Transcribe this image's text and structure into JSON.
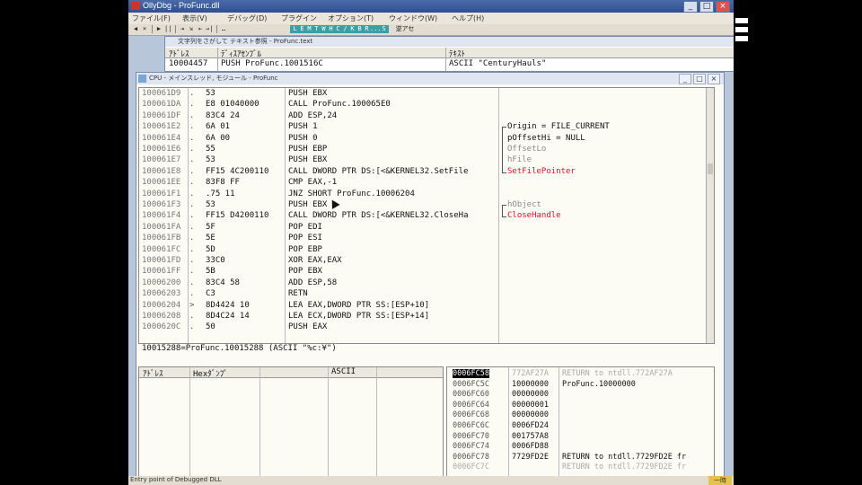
{
  "window": {
    "title": "OllyDbg - ProFunc.dll",
    "controls": [
      "_",
      "□",
      "×"
    ]
  },
  "menu": [
    "ファイル(F)",
    "表示(V)",
    "デバッグ(D)",
    "プラグイン",
    "オプション(T)",
    "ウィンドウ(W)",
    "ヘルプ(H)"
  ],
  "toolbar": {
    "buttons": [
      "◀",
      "×",
      "▶",
      "||",
      "⇥",
      "⇲",
      "⇤",
      "→|",
      "…"
    ],
    "letters": [
      "L",
      "E",
      "M",
      "T",
      "W",
      "H",
      "C",
      "/",
      "K",
      "B",
      "R",
      "...",
      "S"
    ],
    "help": "逆アセ"
  },
  "references": {
    "title": "文字列をさがして テキスト参照 - ProFunc.text",
    "headers": {
      "address": "ｱﾄﾞﾚｽ",
      "disasm": "ﾃﾞｨｽｱｾﾝﾌﾞﾙ",
      "text": "ﾃｷｽﾄ"
    },
    "row": {
      "address": "10004457",
      "disasm": "PUSH ProFunc.1001516C",
      "text": "ASCII \"CenturyHauls\""
    }
  },
  "cpu": {
    "title": "CPU - メインスレッド, モジュール - ProFunc",
    "rows": [
      {
        "addr": "100061D9",
        "mark": ".",
        "hex": "53",
        "instr": "PUSH EBX"
      },
      {
        "addr": "100061DA",
        "mark": ".",
        "hex": "E8 01040000",
        "instr": "CALL ProFunc.100065E0"
      },
      {
        "addr": "100061DF",
        "mark": ".",
        "hex": "83C4 24",
        "instr": "ADD ESP,24"
      },
      {
        "addr": "100061E2",
        "mark": ".",
        "hex": "6A 01",
        "instr": "PUSH 1"
      },
      {
        "addr": "100061E4",
        "mark": ".",
        "hex": "6A 00",
        "instr": "PUSH 0"
      },
      {
        "addr": "100061E6",
        "mark": ".",
        "hex": "55",
        "instr": "PUSH EBP"
      },
      {
        "addr": "100061E7",
        "mark": ".",
        "hex": "53",
        "instr": "PUSH EBX"
      },
      {
        "addr": "100061E8",
        "mark": ".",
        "hex": "FF15 4C200110",
        "instr": "CALL DWORD PTR DS:[<&KERNEL32.SetFile"
      },
      {
        "addr": "100061EE",
        "mark": ".",
        "hex": "83F8 FF",
        "instr": "CMP EAX,-1"
      },
      {
        "addr": "100061F1",
        "mark": ".",
        "hex": ".75 11",
        "instr": "JNZ SHORT ProFunc.10006204"
      },
      {
        "addr": "100061F3",
        "mark": ".",
        "hex": "53",
        "instr": "PUSH EBX"
      },
      {
        "addr": "100061F4",
        "mark": ".",
        "hex": "FF15 D4200110",
        "instr": "CALL DWORD PTR DS:[<&KERNEL32.CloseHa"
      },
      {
        "addr": "100061FA",
        "mark": ".",
        "hex": "5F",
        "instr": "POP EDI"
      },
      {
        "addr": "100061FB",
        "mark": ".",
        "hex": "5E",
        "instr": "POP ESI"
      },
      {
        "addr": "100061FC",
        "mark": ".",
        "hex": "5D",
        "instr": "POP EBP"
      },
      {
        "addr": "100061FD",
        "mark": ".",
        "hex": "33C0",
        "instr": "XOR EAX,EAX"
      },
      {
        "addr": "100061FF",
        "mark": ".",
        "hex": "5B",
        "instr": "POP EBX"
      },
      {
        "addr": "10006200",
        "mark": ".",
        "hex": "83C4 58",
        "instr": "ADD ESP,58"
      },
      {
        "addr": "10006203",
        "mark": ".",
        "hex": "C3",
        "instr": "RETN"
      },
      {
        "addr": "10006204",
        "mark": ">",
        "hex": "8D4424 10",
        "instr": "LEA EAX,DWORD PTR SS:[ESP+10]"
      },
      {
        "addr": "10006208",
        "mark": ".",
        "hex": "8D4C24 14",
        "instr": "LEA ECX,DWORD PTR SS:[ESP+14]"
      },
      {
        "addr": "1000620C",
        "mark": ".",
        "hex": "50",
        "instr": "PUSH EAX"
      }
    ],
    "comments": [
      {
        "row": 3,
        "text": "Origin = FILE_CURRENT",
        "style": "dark"
      },
      {
        "row": 4,
        "text": "pOffsetHi = NULL",
        "style": "dark"
      },
      {
        "row": 5,
        "text": "OffsetLo",
        "style": "grey"
      },
      {
        "row": 6,
        "text": "hFile",
        "style": "grey"
      },
      {
        "row": 7,
        "text": "SetFilePointer",
        "style": "red"
      },
      {
        "row": 10,
        "text": "hObject",
        "style": "grey"
      },
      {
        "row": 11,
        "text": "CloseHandle",
        "style": "red"
      }
    ],
    "info": "10015288=ProFunc.10015288 (ASCII \"%c:¥\")"
  },
  "dump": {
    "headers": {
      "address": "ｱﾄﾞﾚｽ",
      "hex": "Hexﾀﾞﾝﾌﾟ",
      "ascii": "ASCII"
    }
  },
  "stack": {
    "rows": [
      {
        "addr": "0006FC58",
        "val": "772AF27A",
        "cmt": "RETURN to ntdll.772AF27A",
        "sel": true,
        "fade": true
      },
      {
        "addr": "0006FC5C",
        "val": "10000000",
        "cmt": "ProFunc.10000000"
      },
      {
        "addr": "0006FC60",
        "val": "00000000",
        "cmt": ""
      },
      {
        "addr": "0006FC64",
        "val": "00000001",
        "cmt": ""
      },
      {
        "addr": "0006FC68",
        "val": "00000000",
        "cmt": ""
      },
      {
        "addr": "0006FC6C",
        "val": "0006FD24",
        "cmt": ""
      },
      {
        "addr": "0006FC70",
        "val": "001757A8",
        "cmt": ""
      },
      {
        "addr": "0006FC74",
        "val": "0006FD88",
        "cmt": ""
      },
      {
        "addr": "0006FC78",
        "val": "7729FD2E",
        "cmt": "RETURN to ntdll.7729FD2E fr"
      },
      {
        "addr": "0006FC7C",
        "val": "",
        "cmt": "RETURN to ntdll.7729FD2E fr",
        "fade": true
      }
    ]
  },
  "status": {
    "text": "Entry point of Debugged DLL",
    "state": "一時"
  }
}
